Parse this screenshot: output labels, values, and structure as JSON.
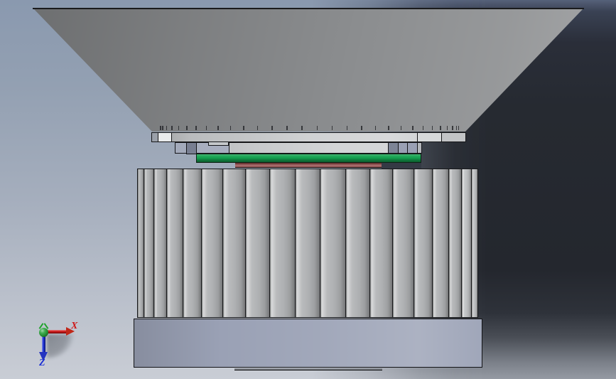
{
  "viewport": {
    "description": "3D CAD shaded viewport, side view of LED downlight assembly",
    "background": {
      "sky_top": "#8a99af",
      "sky_bottom": "#c9cdd5",
      "shadow_top": "#3a4254",
      "shadow_mid": "#24272e",
      "shadow_bottom": "#959aa3"
    }
  },
  "axis_triad": {
    "x_label": "X",
    "z_label": "Z",
    "x_color": "#cf1616",
    "z_color": "#1b2fd4",
    "y_color": "#1fa32c",
    "origin_color": "#2aa33b"
  },
  "model": {
    "shade": {
      "color": "#8b8d8f",
      "facet_marks": 29
    },
    "rim": {
      "color": "#c9cbcd"
    },
    "plate": {
      "color": "#ced0d2"
    },
    "pcb": {
      "color": "#14a14f"
    },
    "thermal_pad": {
      "color": "#a25e5e"
    },
    "heatsink": {
      "color": "#aeb0b2",
      "fin_count": 19
    },
    "base": {
      "color": "#9aa1b5"
    }
  }
}
